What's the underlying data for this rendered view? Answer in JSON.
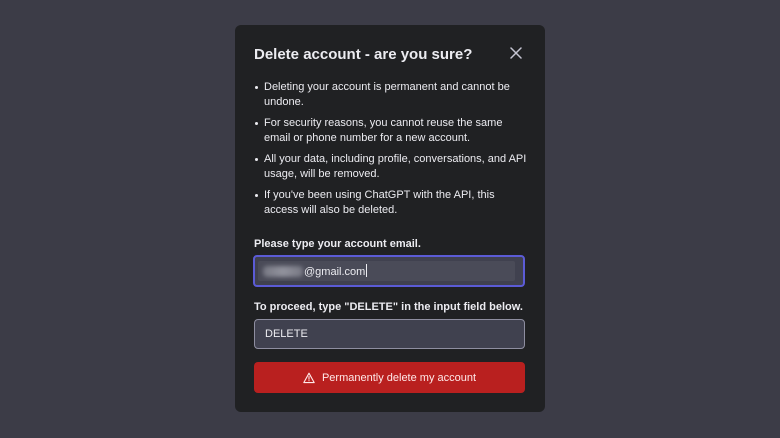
{
  "dialog": {
    "title": "Delete account - are you sure?",
    "close_icon": "close-icon",
    "warnings": [
      "Deleting your account is permanent and cannot be undone.",
      "For security reasons, you cannot reuse the same email or phone number for a new account.",
      "All your data, including profile, conversations, and API usage, will be removed.",
      "If you've been using ChatGPT with the API, this access will also be deleted."
    ],
    "email_label": "Please type your account email.",
    "email_value_visible": "@gmail.com",
    "delete_label": "To proceed, type \"DELETE\" in the input field below.",
    "delete_value": "DELETE",
    "delete_button_label": "Permanently delete my account",
    "delete_button_icon": "warning-icon"
  },
  "colors": {
    "background": "#3c3c47",
    "dialog": "#202123",
    "input": "#40414f",
    "focus_border": "#5b5bd6",
    "danger": "#b9201f",
    "text": "#ececf1"
  }
}
